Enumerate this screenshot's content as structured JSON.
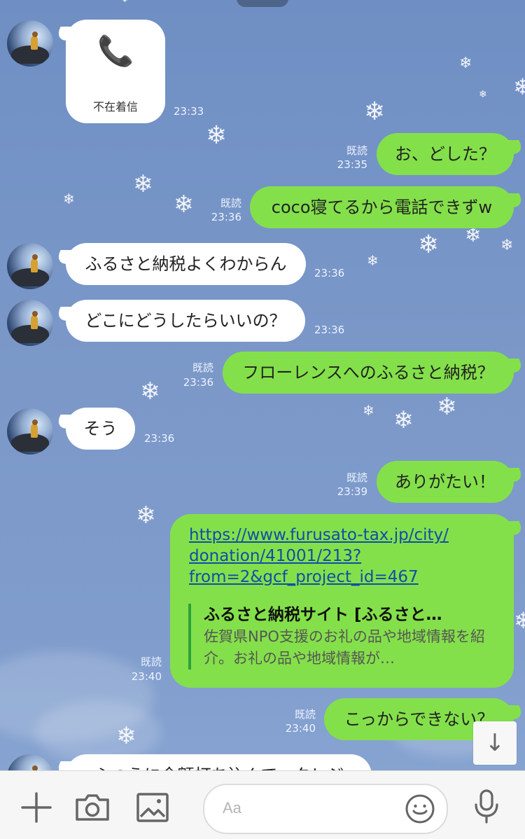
{
  "messages": [
    {
      "type": "call",
      "label": "不在着信",
      "time": "23:33"
    },
    {
      "type": "outgoing",
      "text": "お、どした？",
      "read": "既読",
      "time": "23:35"
    },
    {
      "type": "outgoing",
      "text": "coco寝てるから電話できずw",
      "read": "既読",
      "time": "23:36"
    },
    {
      "type": "incoming",
      "text": "ふるさと納税よくわからん",
      "time": "23:36"
    },
    {
      "type": "incoming",
      "text": "どこにどうしたらいいの？",
      "time": "23:36"
    },
    {
      "type": "outgoing",
      "text": "フローレンスへのふるさと納税？",
      "read": "既読",
      "time": "23:36"
    },
    {
      "type": "incoming",
      "text": "そう",
      "time": "23:36"
    },
    {
      "type": "outgoing",
      "text": "ありがたい！",
      "read": "既読",
      "time": "23:39"
    },
    {
      "type": "link",
      "lines": [
        "https://www.furusato-tax.jp/city/",
        "donation/41001/213?",
        "from=2&gcf_project_id=467"
      ],
      "preview_title": "ふるさと納税サイト [ふるさと…",
      "preview_desc": "佐賀県NPO支援のお礼の品や地域情報を紹介。お礼の品や地域情報が…",
      "read": "既読",
      "time": "23:40"
    },
    {
      "type": "outgoing",
      "text": "こっからできない？",
      "read": "既読",
      "time": "23:40"
    },
    {
      "type": "incoming",
      "text": "ふつうに金額打ち込んで、クレジ",
      "time": ""
    }
  ],
  "toolbar": {
    "input_placeholder": "Aa",
    "icons": [
      "plus-icon",
      "camera-icon",
      "image-icon",
      "emoji-icon",
      "microphone-icon"
    ]
  },
  "scroll_button": {
    "icon": "arrow-down-icon"
  }
}
